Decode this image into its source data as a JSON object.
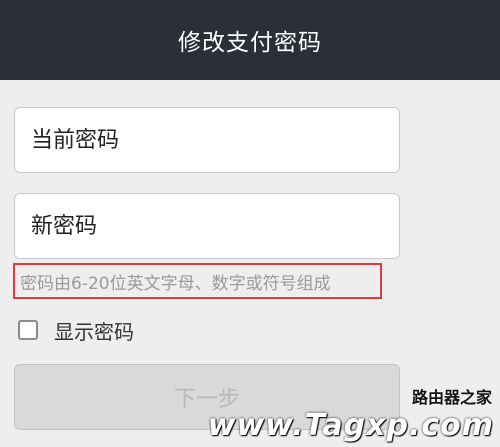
{
  "header": {
    "title": "修改支付密码"
  },
  "form": {
    "current_password_placeholder": "当前密码",
    "new_password_placeholder": "新密码",
    "hint": "密码由6-20位英文字母、数字或符号组成",
    "show_password_label": "显示密码",
    "show_password_checked": false,
    "next_button_label": "下一步"
  },
  "watermark": {
    "line1": "路由器之家",
    "line2": "www.Tagxp.com"
  },
  "colors": {
    "header_bg": "#2b2f3a",
    "page_bg": "#eeeeee",
    "hint_border": "#e03c3c",
    "button_disabled_bg": "#d9d9d9"
  }
}
